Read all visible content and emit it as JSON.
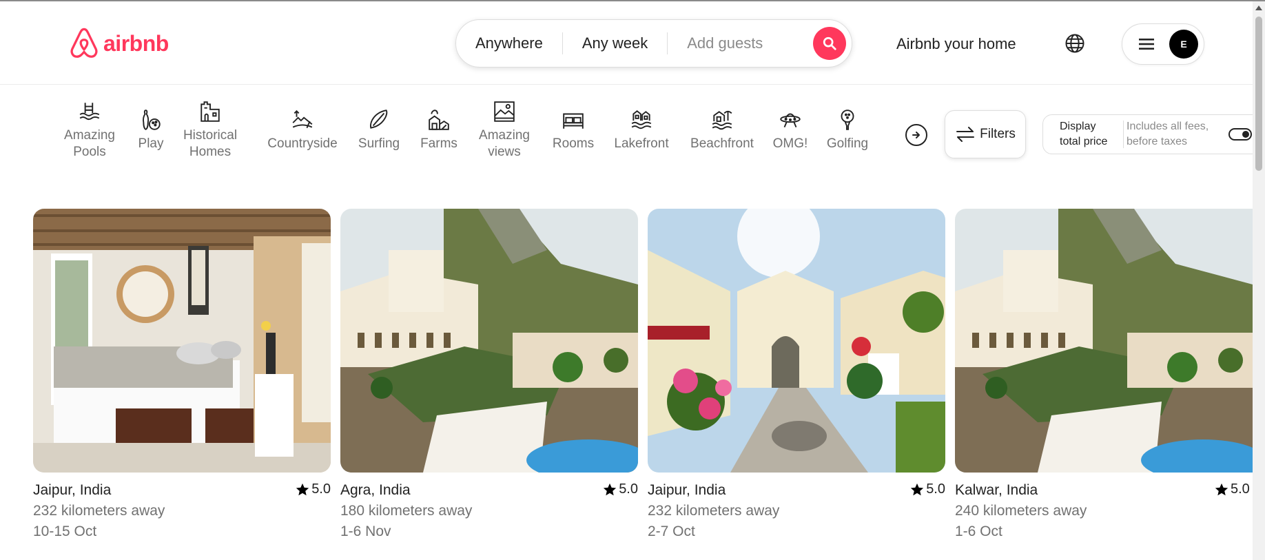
{
  "brand": {
    "name": "airbnb",
    "color": "#ff385c"
  },
  "search": {
    "where": "Anywhere",
    "when": "Any week",
    "guests_placeholder": "Add guests"
  },
  "header": {
    "host_link": "Airbnb your home",
    "avatar_initial": "E"
  },
  "categories": [
    {
      "label_line1": "Amazing",
      "label_line2": "Pools",
      "icon": "pool-icon"
    },
    {
      "label_line1": "Play",
      "label_line2": "",
      "icon": "bowling-icon"
    },
    {
      "label_line1": "Historical",
      "label_line2": "Homes",
      "icon": "historical-home-icon"
    },
    {
      "label_line1": "Countryside",
      "label_line2": "",
      "icon": "countryside-icon"
    },
    {
      "label_line1": "Surfing",
      "label_line2": "",
      "icon": "surfboard-icon"
    },
    {
      "label_line1": "Farms",
      "label_line2": "",
      "icon": "farm-icon"
    },
    {
      "label_line1": "Amazing",
      "label_line2": "views",
      "icon": "view-icon"
    },
    {
      "label_line1": "Rooms",
      "label_line2": "",
      "icon": "bed-icon"
    },
    {
      "label_line1": "Lakefront",
      "label_line2": "",
      "icon": "lakefront-icon"
    },
    {
      "label_line1": "Beachfront",
      "label_line2": "",
      "icon": "beach-icon"
    },
    {
      "label_line1": "OMG!",
      "label_line2": "",
      "icon": "ufo-icon"
    },
    {
      "label_line1": "Golfing",
      "label_line2": "",
      "icon": "golf-icon"
    }
  ],
  "filters": {
    "label": "Filters"
  },
  "price_toggle": {
    "main_line1": "Display",
    "main_line2": "total price",
    "sub_line1": "Includes all fees,",
    "sub_line2": "before taxes",
    "enabled": false
  },
  "listings": [
    {
      "location": "Jaipur, India",
      "rating": "5.0",
      "distance": "232 kilometers away",
      "dates": "10-15 Oct"
    },
    {
      "location": "Agra, India",
      "rating": "5.0",
      "distance": "180 kilometers away",
      "dates": "1-6 Nov"
    },
    {
      "location": "Jaipur, India",
      "rating": "5.0",
      "distance": "232 kilometers away",
      "dates": "2-7 Oct"
    },
    {
      "location": "Kalwar, India",
      "rating": "5.0",
      "distance": "240 kilometers away",
      "dates": "1-6 Oct"
    }
  ]
}
